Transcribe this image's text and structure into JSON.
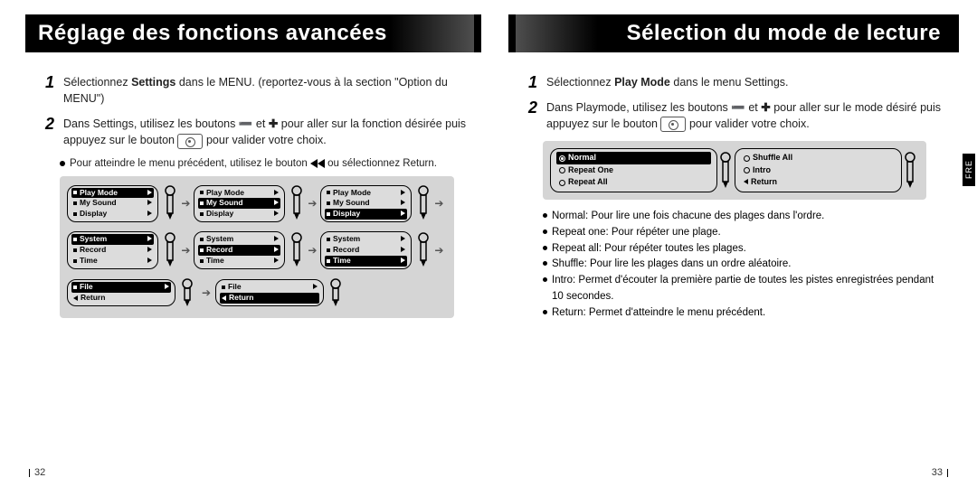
{
  "left": {
    "title": "Réglage des fonctions avancées",
    "step1_pre": "Sélectionnez ",
    "step1_bold": "Settings",
    "step1_post": " dans le MENU. (reportez-vous à la section \"Option du MENU\")",
    "step2a_pre": "Dans Settings, utilisez les boutons ",
    "step2a_mid": " et ",
    "step2a_post": " pour aller sur la fonction désirée puis",
    "step2b_pre": "appuyez sur le bouton ",
    "step2b_post": " pour valider votre choix.",
    "note_pre": "Pour atteindre le menu précédent, utilisez le bouton ",
    "note_post": " ou sélectionnez Return.",
    "menu": {
      "playmode": "Play Mode",
      "mysound": "My Sound",
      "display": "Display",
      "system": "System",
      "record": "Record",
      "time": "Time",
      "file": "File",
      "return": "Return"
    },
    "page": "32"
  },
  "right": {
    "title": "Sélection du mode de lecture",
    "step1_pre": "Sélectionnez ",
    "step1_bold": "Play Mode",
    "step1_post": " dans le menu Settings.",
    "step2a_pre": "Dans Playmode, utilisez les boutons ",
    "step2a_mid": " et ",
    "step2a_post": " pour aller sur le mode désiré puis",
    "step2b_pre": "appuyez sur le bouton ",
    "step2b_post": " pour valider votre choix.",
    "pm": {
      "normal": "Normal",
      "repeat_one": "Repeat One",
      "repeat_all": "Repeat All",
      "shuffle_all": "Shuffle All",
      "intro": "Intro",
      "return": "Return"
    },
    "desc": {
      "normal": "Normal: Pour lire une fois chacune des plages dans l'ordre.",
      "repeat_one": "Repeat one: Pour répéter une plage.",
      "repeat_all": "Repeat all: Pour répéter toutes les plages.",
      "shuffle": "Shuffle: Pour lire les plages dans un ordre aléatoire.",
      "intro": "Intro: Permet d'écouter la première partie de toutes les pistes enregistrées pendant 10 secondes.",
      "return": "Return: Permet d'atteindre le menu précédent."
    },
    "page": "33",
    "lang_tab": "FRE"
  },
  "glyph": {
    "minus": "➖",
    "plus": "✚",
    "arrow": "➔"
  }
}
